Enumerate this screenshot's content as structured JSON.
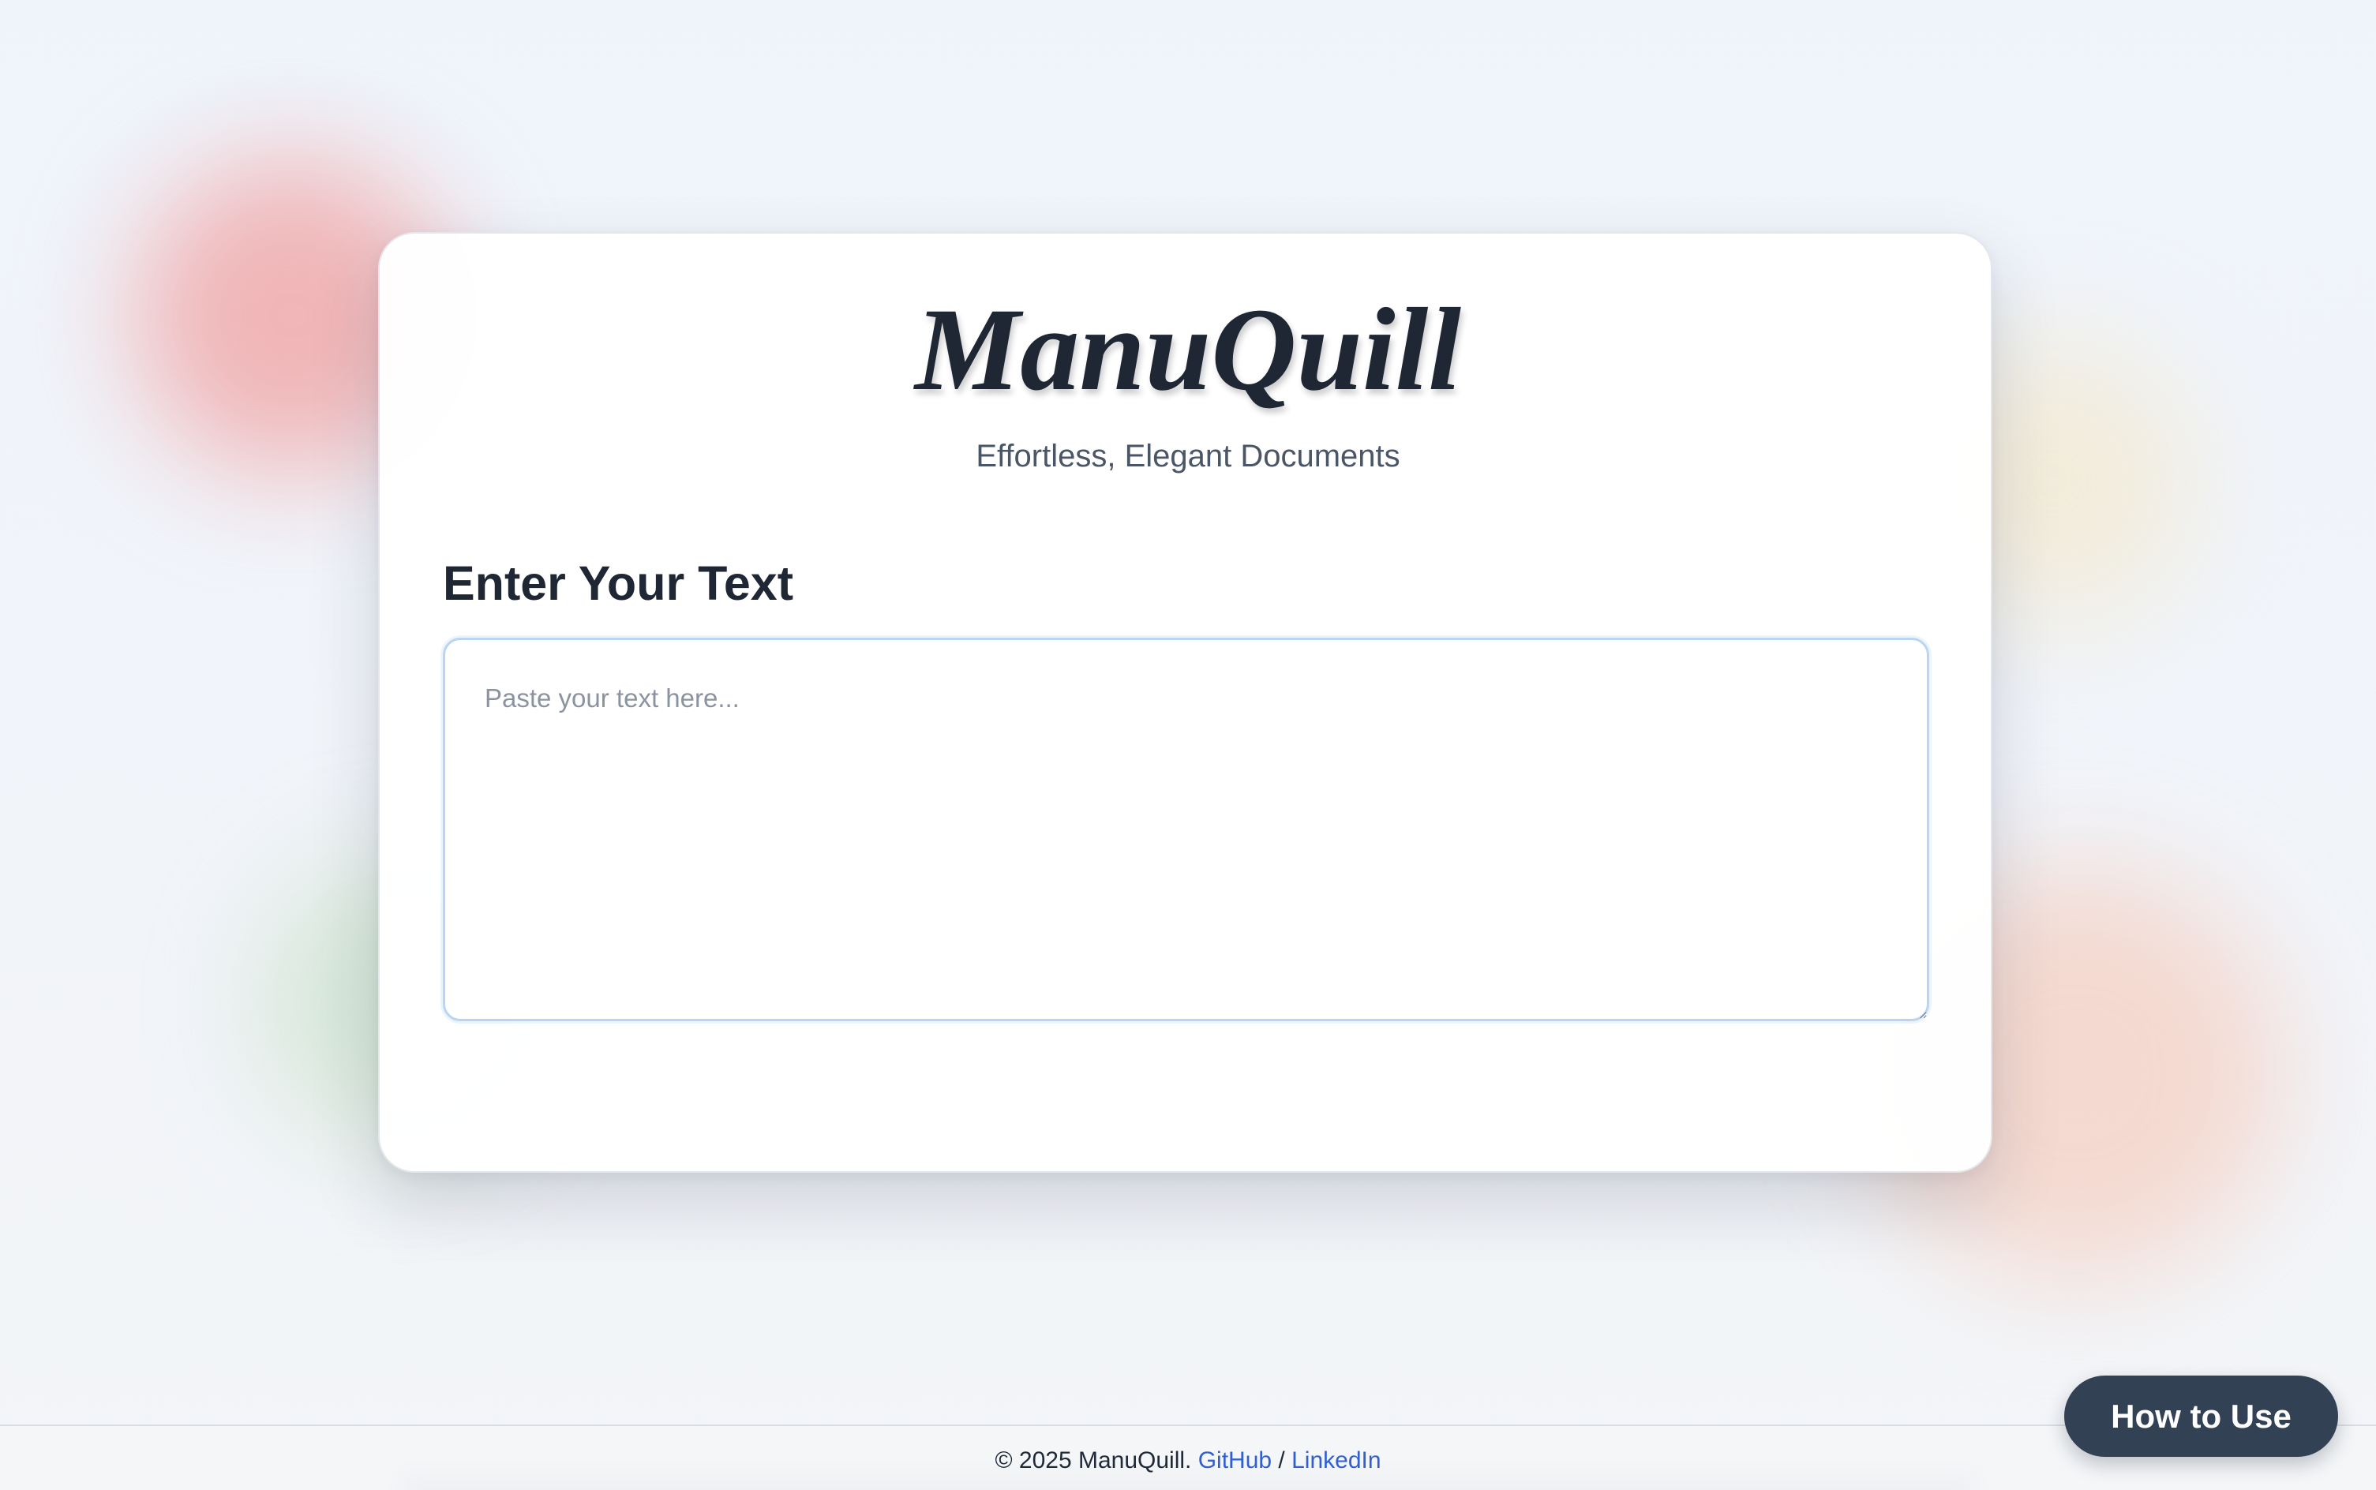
{
  "header": {
    "title": "ManuQuill",
    "tagline": "Effortless, Elegant Documents"
  },
  "editor": {
    "heading": "Enter Your Text",
    "value": "",
    "placeholder": "Paste your text here..."
  },
  "footer": {
    "copyright": "© 2025 ManuQuill.",
    "github_label": "GitHub",
    "separator": "/",
    "linkedin_label": "LinkedIn"
  },
  "help_button": {
    "label": "How to Use"
  },
  "colors": {
    "title_text": "#1e2733",
    "link": "#2f5fd0",
    "input_border": "#b9d5f2",
    "button_bg": "#334155"
  }
}
